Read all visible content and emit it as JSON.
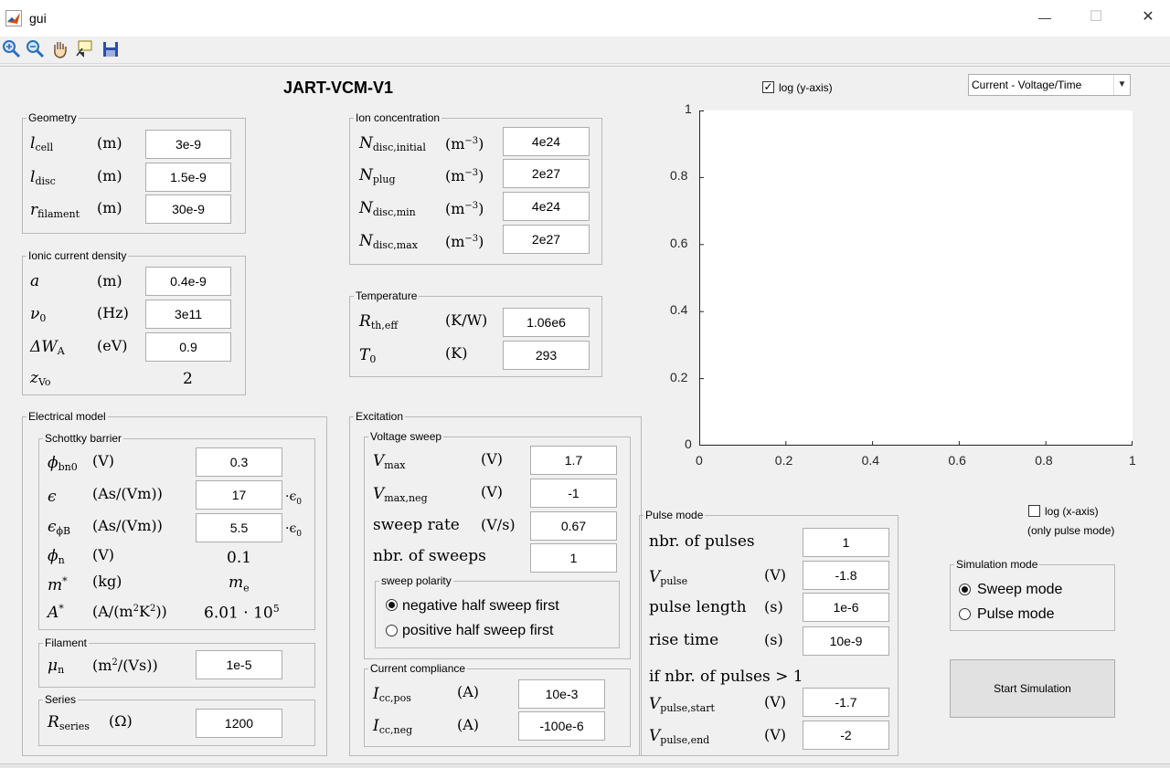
{
  "window": {
    "title": "gui",
    "minimize": "—",
    "maximize": "☐",
    "close": "✕"
  },
  "toolbar": {
    "icons": [
      "zoom-in-icon",
      "zoom-out-icon",
      "pan-hand-icon",
      "data-cursor-icon",
      "save-icon"
    ]
  },
  "app_title": "JART-VCM-V1",
  "plot_controls": {
    "log_y_label": "log (y-axis)",
    "log_y_checked": true,
    "plot_select": "Current - Voltage/Time",
    "log_x_label": "log (x-axis)",
    "log_x_checked": false,
    "only_pulse": "(only pulse mode)"
  },
  "geometry": {
    "title": "Geometry",
    "rows": [
      {
        "sym": "l",
        "sub": "cell",
        "unit": "(m)",
        "value": "3e-9"
      },
      {
        "sym": "l",
        "sub": "disc",
        "unit": "(m)",
        "value": "1.5e-9"
      },
      {
        "sym": "r",
        "sub": "filament",
        "unit": "(m)",
        "value": "30e-9"
      }
    ]
  },
  "ionic": {
    "title": "Ionic current density",
    "rows": [
      {
        "sym": "a",
        "sub": "",
        "unit": "(m)",
        "value": "0.4e-9"
      },
      {
        "sym": "ν",
        "sub": "0",
        "unit": "(Hz)",
        "value": "3e11"
      },
      {
        "sym": "ΔW",
        "sub": "A",
        "unit": "(eV)",
        "value": "0.9"
      }
    ],
    "zvo": {
      "sym": "z",
      "sub": "Vo",
      "value": "2"
    }
  },
  "ion_conc": {
    "title": "Ion concentration",
    "unit_base": "(m",
    "unit_exp": "−3",
    "unit_close": ")",
    "rows": [
      {
        "sym": "N",
        "sub": "disc,initial",
        "value": "4e24"
      },
      {
        "sym": "N",
        "sub": "plug",
        "value": "2e27"
      },
      {
        "sym": "N",
        "sub": "disc,min",
        "value": "4e24"
      },
      {
        "sym": "N",
        "sub": "disc,max",
        "value": "2e27"
      }
    ]
  },
  "temperature": {
    "title": "Temperature",
    "rows": [
      {
        "sym": "R",
        "sub": "th,eff",
        "unit": "(K/W)",
        "value": "1.06e6"
      },
      {
        "sym": "T",
        "sub": "0",
        "unit": "(K)",
        "value": "293"
      }
    ]
  },
  "electrical": {
    "title": "Electrical model",
    "schottky": {
      "title": "Schottky barrier",
      "rows": [
        {
          "sym": "ϕ",
          "sub": "bn0",
          "unit": "(V)",
          "value": "0.3"
        },
        {
          "sym": "ϵ",
          "sub": "",
          "unit": "(As/(Vm))",
          "value": "17",
          "suffix": "·ϵ",
          "suffix_sub": "0"
        },
        {
          "sym": "ϵ",
          "sub": "ϕB",
          "unit": "(As/(Vm))",
          "value": "5.5",
          "suffix": "·ϵ",
          "suffix_sub": "0"
        },
        {
          "sym": "ϕ",
          "sub": "n",
          "unit": "(V)",
          "value": "0.1"
        },
        {
          "sym": "m",
          "sub": "",
          "unit": "(kg)",
          "value": "m",
          "value_sub": "e"
        },
        {
          "sym": "A",
          "sub": "",
          "unit": "(A/(m",
          "value": "6.01 · 10",
          "value_sup": "5"
        }
      ]
    },
    "filament": {
      "title": "Filament",
      "sym": "μ",
      "sub": "n",
      "unit": "(m",
      "unit_exp": "2",
      "unit_rest": "/(Vs))",
      "value": "1e-5"
    },
    "series": {
      "title": "Series",
      "sym": "R",
      "sub": "series",
      "unit": "(Ω)",
      "value": "1200"
    }
  },
  "excitation": {
    "title": "Excitation",
    "sweep": {
      "title": "Voltage sweep",
      "rows": [
        {
          "sym": "V",
          "sub": "max",
          "unit": "(V)",
          "value": "1.7"
        },
        {
          "sym": "V",
          "sub": "max,neg",
          "unit": "(V)",
          "value": "-1"
        },
        {
          "label": "sweep rate",
          "unit": "(V/s)",
          "value": "0.67"
        },
        {
          "label": "nbr. of sweeps",
          "unit": "",
          "value": "1"
        }
      ],
      "polarity": {
        "title": "sweep polarity",
        "opt1": "negative half sweep first",
        "opt2": "positive half sweep first",
        "selected": 1
      }
    },
    "compliance": {
      "title": "Current compliance",
      "rows": [
        {
          "sym": "I",
          "sub": "cc,pos",
          "unit": "(A)",
          "value": "10e-3"
        },
        {
          "sym": "I",
          "sub": "cc,neg",
          "unit": "(A)",
          "value": "-100e-6"
        }
      ]
    }
  },
  "pulse": {
    "title": "Pulse mode",
    "rows": [
      {
        "label": "nbr. of pulses",
        "unit": "",
        "value": "1"
      },
      {
        "sym": "V",
        "sub": "pulse",
        "unit": "(V)",
        "value": "-1.8"
      },
      {
        "label": "pulse length",
        "unit": "(s)",
        "value": "1e-6"
      },
      {
        "label": "rise time",
        "unit": "(s)",
        "value": "10e-9"
      }
    ],
    "if_label": "if nbr. of pulses > 1",
    "rows2": [
      {
        "sym": "V",
        "sub": "pulse,start",
        "unit": "(V)",
        "value": "-1.7"
      },
      {
        "sym": "V",
        "sub": "pulse,end",
        "unit": "(V)",
        "value": "-2"
      }
    ]
  },
  "sim_mode": {
    "title": "Simulation mode",
    "opt1": "Sweep mode",
    "opt2": "Pulse mode",
    "selected": 1
  },
  "start_button": "Start Simulation",
  "chart_data": {
    "type": "line",
    "title": "",
    "xlabel": "",
    "ylabel": "",
    "xlim": [
      0,
      1
    ],
    "ylim": [
      0,
      1
    ],
    "xticks": [
      "0",
      "0.2",
      "0.4",
      "0.6",
      "0.8",
      "1"
    ],
    "yticks": [
      "0",
      "0.2",
      "0.4",
      "0.6",
      "0.8",
      "1"
    ],
    "series": []
  }
}
